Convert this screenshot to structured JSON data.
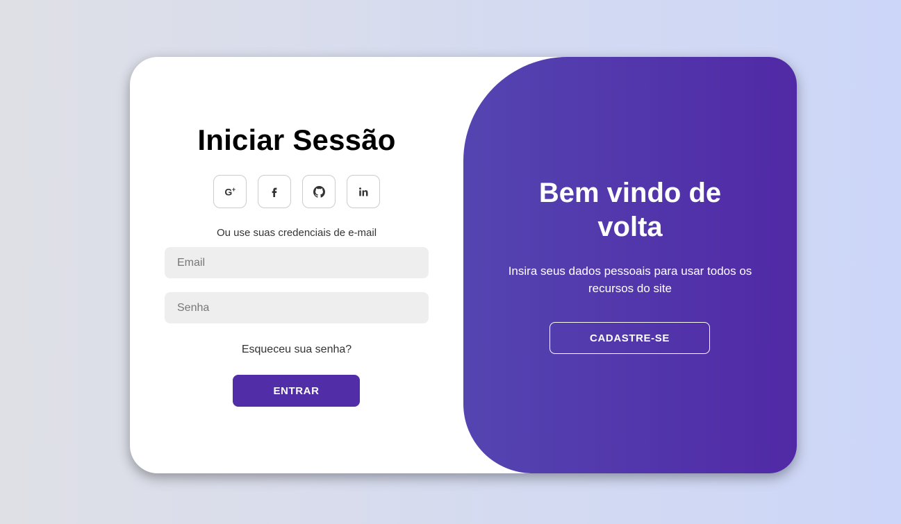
{
  "signin": {
    "title": "Iniciar Sessão",
    "socials": [
      {
        "icon": "google-plus-icon",
        "label": "G+"
      },
      {
        "icon": "facebook-icon",
        "label": "f"
      },
      {
        "icon": "github-icon",
        "label": ""
      },
      {
        "icon": "linkedin-icon",
        "label": "in"
      }
    ],
    "alt_text": "Ou use suas credenciais de e-mail",
    "email_placeholder": "Email",
    "password_placeholder": "Senha",
    "forgot_link": "Esqueceu sua senha?",
    "enter_label": "ENTRAR"
  },
  "panel": {
    "title": "Bem vindo de volta",
    "description": "Insira seus dados pessoais para usar todos os recursos do site",
    "signup_label": "CADASTRE-SE"
  },
  "colors": {
    "accent": "#512da8",
    "panel_gradient_start": "#5445b1",
    "panel_gradient_end": "#5129a6",
    "input_background": "#eeeeee"
  }
}
